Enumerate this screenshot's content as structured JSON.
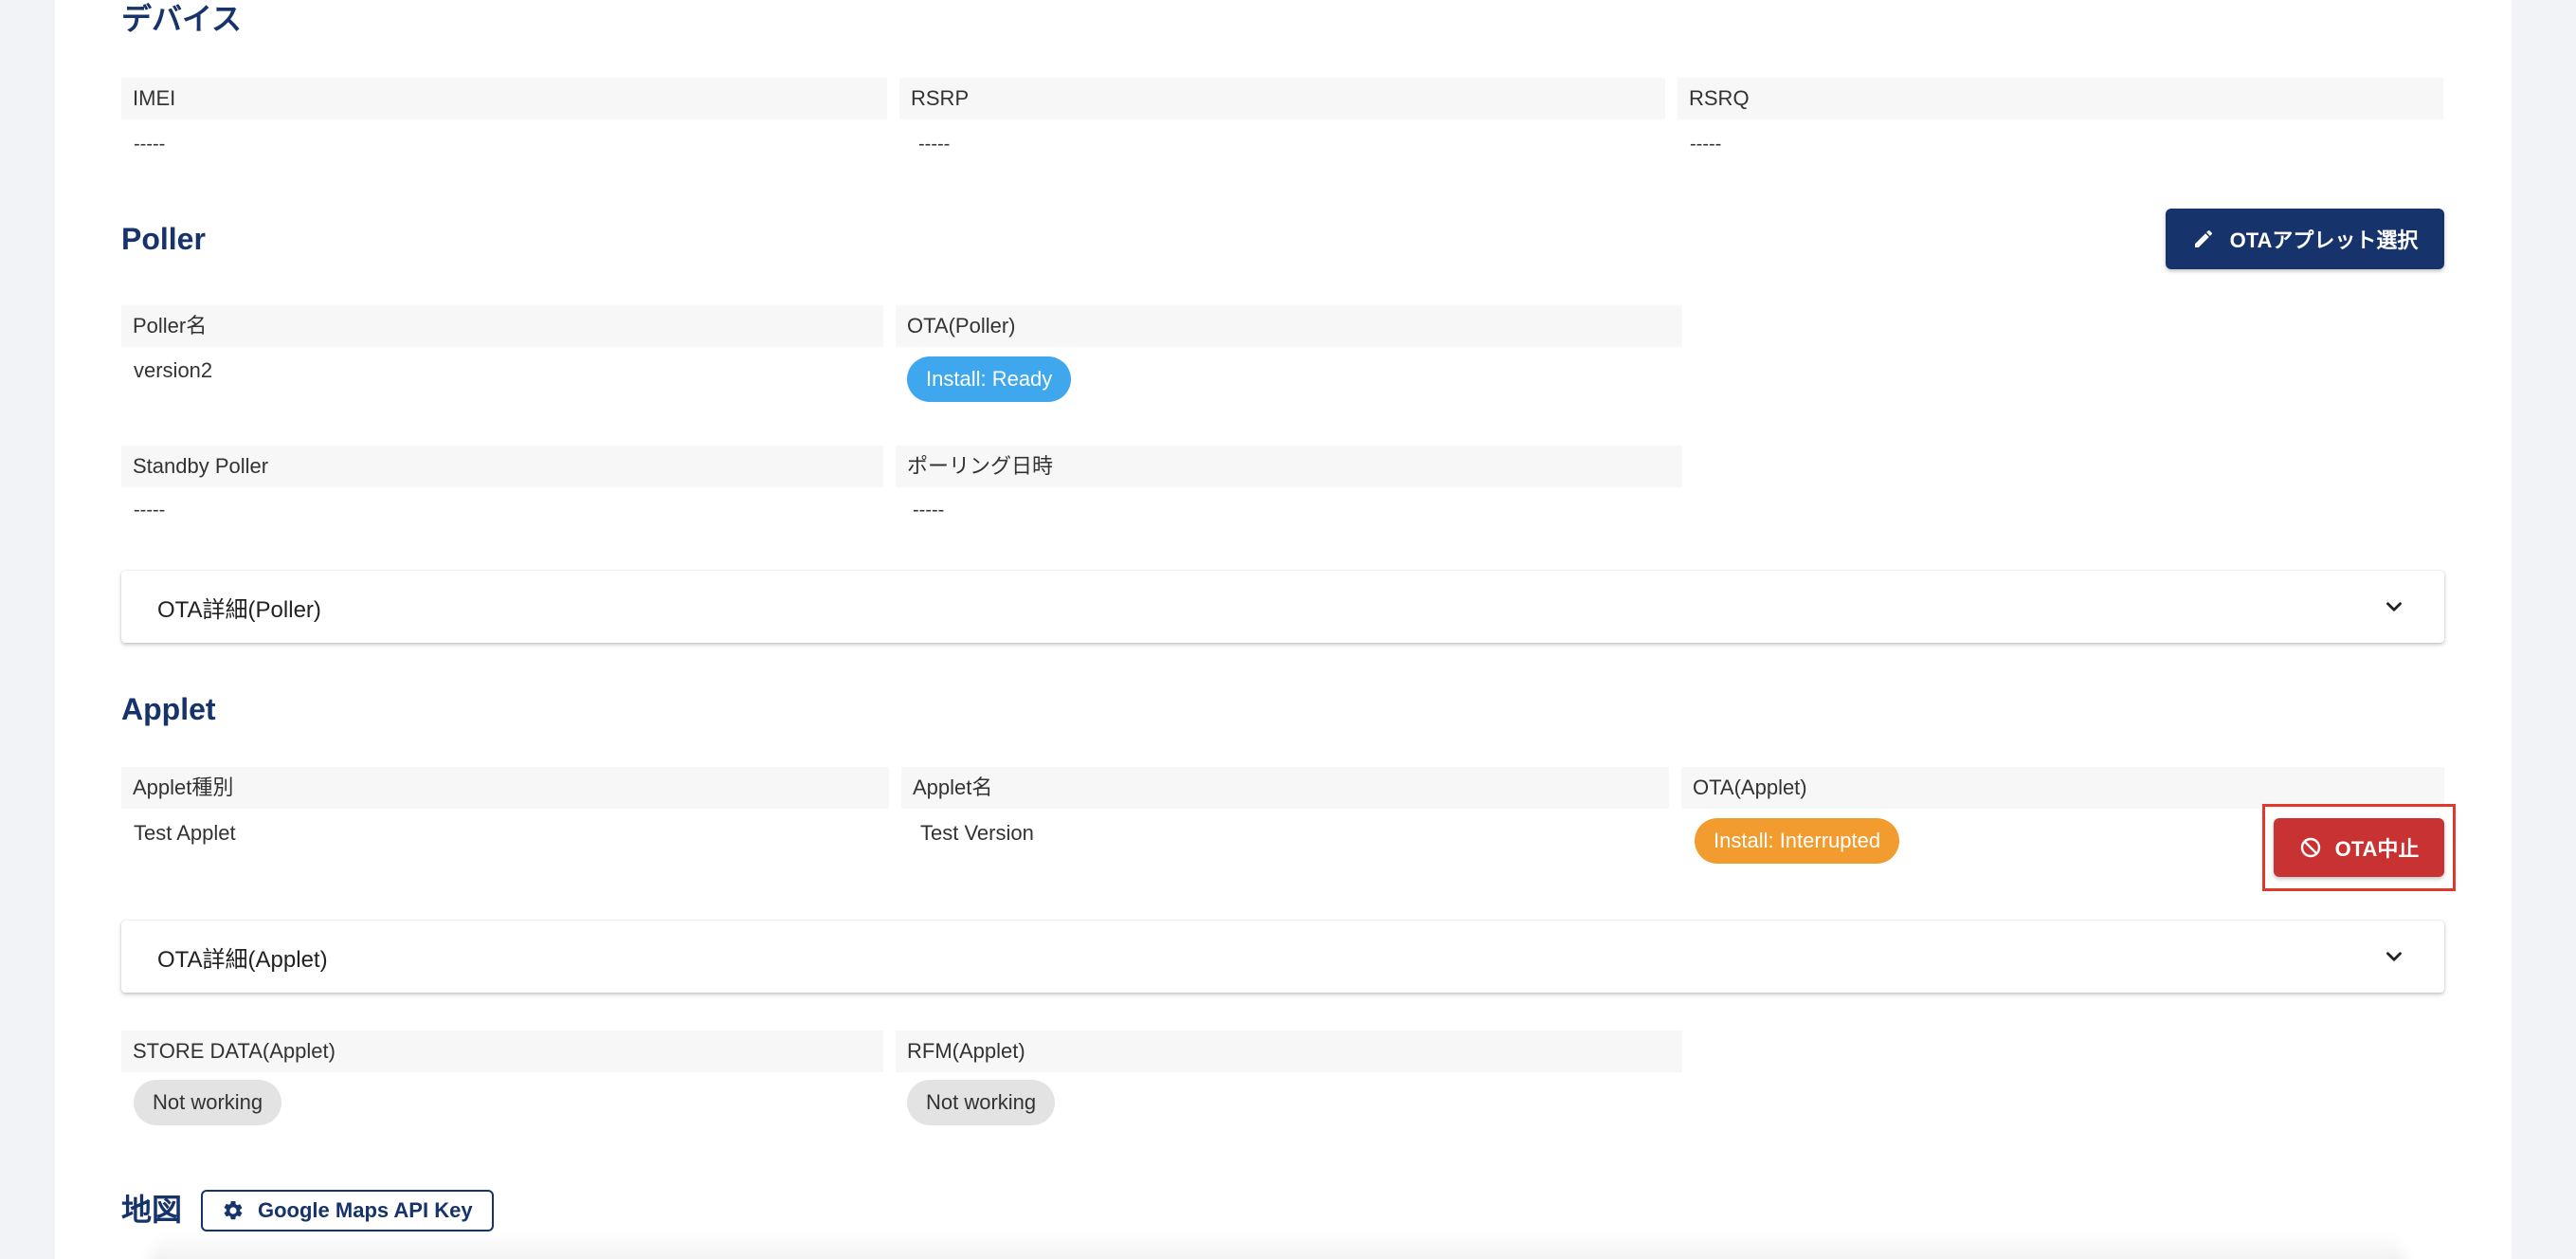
{
  "device": {
    "title": "デバイス",
    "fields": [
      {
        "label": "IMEI",
        "value": "-----"
      },
      {
        "label": "RSRP",
        "value": "-----"
      },
      {
        "label": "RSRQ",
        "value": "-----"
      }
    ]
  },
  "poller": {
    "title": "Poller",
    "select_button": "OTAアプレット選択",
    "name_label": "Poller名",
    "name_value": "version2",
    "ota_label": "OTA(Poller)",
    "ota_status": "Install: Ready",
    "standby_label": "Standby Poller",
    "standby_value": "-----",
    "polling_label": "ポーリング日時",
    "polling_value": "-----",
    "accordion_label": "OTA詳細(Poller)"
  },
  "applet": {
    "title": "Applet",
    "type_label": "Applet種別",
    "type_value": "Test Applet",
    "name_label": "Applet名",
    "name_value": "Test Version",
    "ota_label": "OTA(Applet)",
    "ota_status": "Install: Interrupted",
    "stop_button": "OTA中止",
    "accordion_label": "OTA詳細(Applet)",
    "store_label": "STORE DATA(Applet)",
    "store_status": "Not working",
    "rfm_label": "RFM(Applet)",
    "rfm_status": "Not working"
  },
  "map": {
    "title": "地図",
    "api_key_button": "Google Maps API Key"
  },
  "colors": {
    "primary": "#16336b",
    "ready": "#3fa7ee",
    "interrupted": "#f29b2e",
    "danger": "#c93232"
  }
}
